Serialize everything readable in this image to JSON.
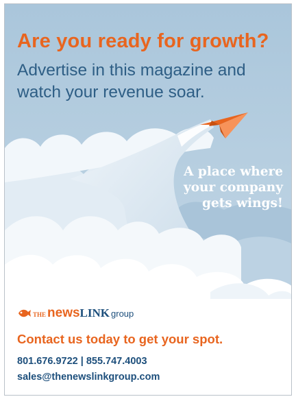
{
  "headline": "Are you ready for growth?",
  "subhead": "Advertise in this magazine and watch your revenue soar.",
  "tagline": "A place where your company gets wings!",
  "logo": {
    "prefix": "THE",
    "news": "news",
    "link": "LINK",
    "group": "group"
  },
  "cta": "Contact us today to get your spot.",
  "contact": {
    "phone": "801.676.9722 | 855.747.4003",
    "email": "sales@thenewslinkgroup.com"
  },
  "colors": {
    "accent": "#e8651f",
    "brand_blue": "#1d4f7c",
    "subhead_blue": "#2e5e85",
    "sky": "#b6cedf"
  }
}
